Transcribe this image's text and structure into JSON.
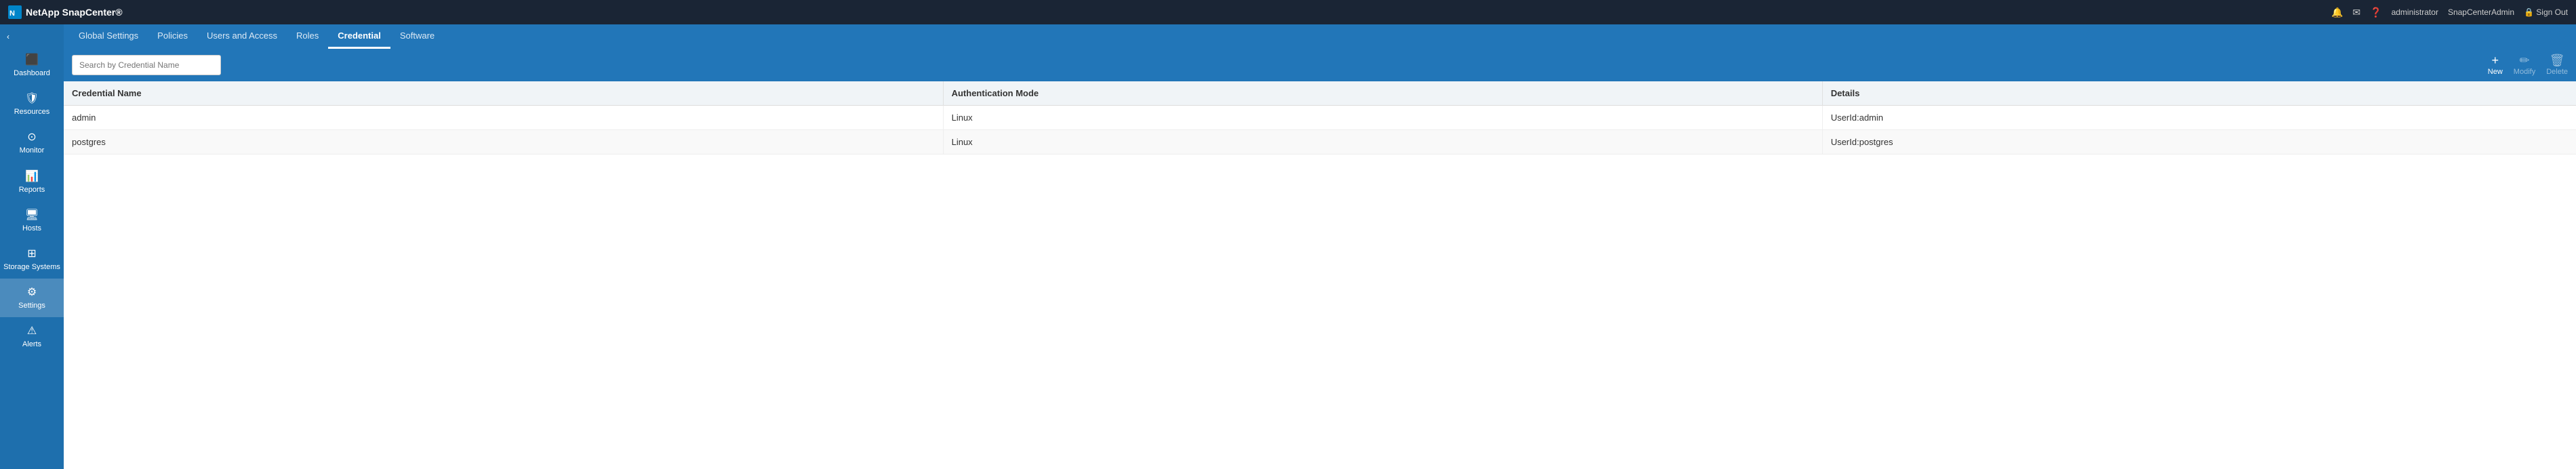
{
  "app": {
    "logo_text": "NetApp SnapCenter®",
    "logo_icon": "⬛"
  },
  "topbar": {
    "notification_icon": "🔔",
    "mail_icon": "✉",
    "help_icon": "❓",
    "user_label": "administrator",
    "admin_label": "SnapCenterAdmin",
    "signout_label": "Sign Out",
    "signout_icon": "🔒"
  },
  "sidebar": {
    "collapse_icon": "‹",
    "items": [
      {
        "id": "dashboard",
        "label": "Dashboard",
        "icon": "⊞"
      },
      {
        "id": "resources",
        "label": "Resources",
        "icon": "🛡"
      },
      {
        "id": "monitor",
        "label": "Monitor",
        "icon": "⊙"
      },
      {
        "id": "reports",
        "label": "Reports",
        "icon": "📊"
      },
      {
        "id": "hosts",
        "label": "Hosts",
        "icon": "🖥"
      },
      {
        "id": "storage-systems",
        "label": "Storage Systems",
        "icon": "⊞"
      },
      {
        "id": "settings",
        "label": "Settings",
        "icon": "⚙",
        "active": true
      },
      {
        "id": "alerts",
        "label": "Alerts",
        "icon": "⚠"
      }
    ]
  },
  "subnav": {
    "tabs": [
      {
        "id": "global-settings",
        "label": "Global Settings",
        "active": false
      },
      {
        "id": "policies",
        "label": "Policies",
        "active": false
      },
      {
        "id": "users-and-access",
        "label": "Users and Access",
        "active": false
      },
      {
        "id": "roles",
        "label": "Roles",
        "active": false
      },
      {
        "id": "credential",
        "label": "Credential",
        "active": true
      },
      {
        "id": "software",
        "label": "Software",
        "active": false
      }
    ]
  },
  "toolbar": {
    "search_placeholder": "Search by Credential Name",
    "search_value": "",
    "buttons": {
      "new_label": "New",
      "new_icon": "+",
      "modify_label": "Modify",
      "modify_icon": "✏",
      "delete_label": "Delete",
      "delete_icon": "🗑"
    }
  },
  "table": {
    "columns": [
      {
        "id": "credential-name",
        "label": "Credential Name"
      },
      {
        "id": "auth-mode",
        "label": "Authentication Mode"
      },
      {
        "id": "details",
        "label": "Details"
      }
    ],
    "rows": [
      {
        "credential_name": "admin",
        "auth_mode": "Linux",
        "details": "UserId:admin"
      },
      {
        "credential_name": "postgres",
        "auth_mode": "Linux",
        "details": "UserId:postgres"
      }
    ]
  }
}
